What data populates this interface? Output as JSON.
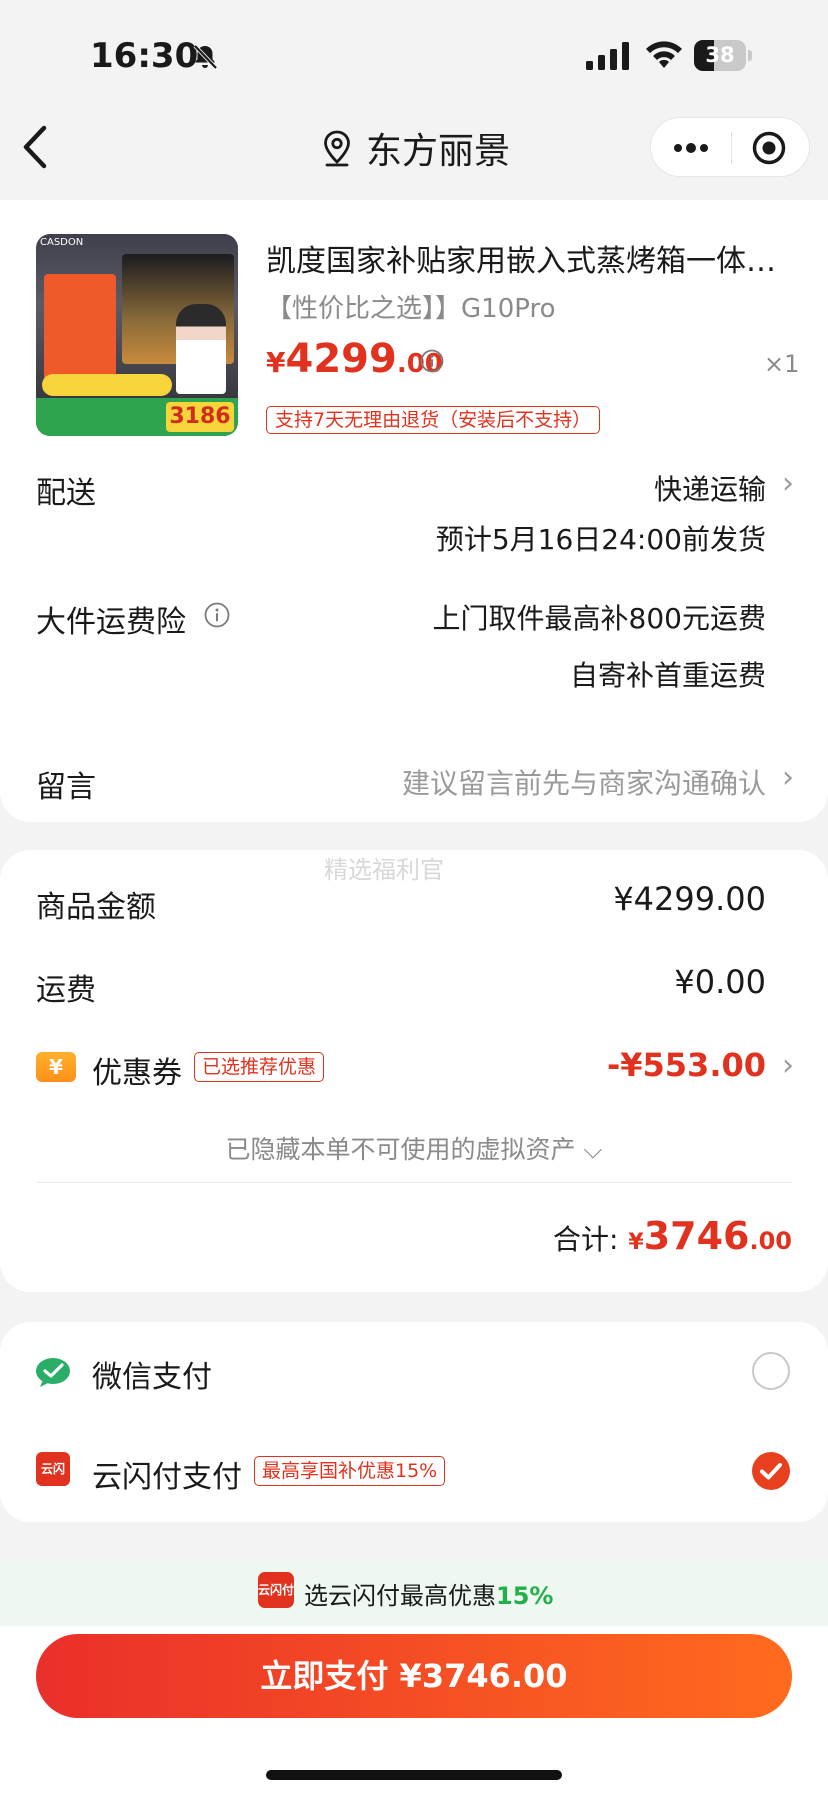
{
  "status_bar": {
    "time": "16:30",
    "battery": "38",
    "battery_level": 0.38
  },
  "nav": {
    "title": "东方丽景"
  },
  "product": {
    "title": "凯度国家补贴家用嵌入式蒸烤箱一体…",
    "spec": "【性价比之选】】G10Pro",
    "price_symbol": "¥",
    "price_int": "4299",
    "price_dec": ".00",
    "quantity": "×1",
    "return_tag": "支持7天无理由退货（安装后不支持）",
    "image_text": {
      "brand": "CASDON",
      "badge_price": "3186"
    }
  },
  "delivery": {
    "label": "配送",
    "method": "快递运输",
    "estimate": "预计5月16日24:00前发货"
  },
  "insurance": {
    "label": "大件运费险",
    "line1": "上门取件最高补800元运费",
    "line2": "自寄补首重运费"
  },
  "message": {
    "label": "留言",
    "hint": "建议留言前先与商家沟通确认"
  },
  "summary": {
    "watermark": "精选福利官",
    "goods_label": "商品金额",
    "goods_value": "¥4299.00",
    "shipping_label": "运费",
    "shipping_value": "¥0.00",
    "coupon_icon": "¥",
    "coupon_label": "优惠券",
    "coupon_tag": "已选推荐优惠",
    "coupon_value": "-¥553.00",
    "hidden_note": "已隐藏本单不可使用的虚拟资产 ⌵",
    "total_label": "合计:",
    "total_symbol": "¥",
    "total_int": "3746",
    "total_dec": ".00"
  },
  "payment": {
    "wechat_label": "微信支付",
    "wechat_selected": false,
    "yunshanfu_icon": "云闪付",
    "yunshanfu_label": "云闪付支付",
    "yunshanfu_tag": "最高享国补优惠15%",
    "yunshanfu_selected": true
  },
  "promo": {
    "icon": "云闪付",
    "text": "选云闪付最高优惠",
    "percent": "15%"
  },
  "pay_button": {
    "label": "立即支付 ¥3746.00"
  },
  "colors": {
    "accent": "#e0321e",
    "button_start": "#ea2f2a",
    "button_end": "#ff6b1e",
    "promo_green": "#22b04a",
    "wechat_green": "#2aae67"
  },
  "icons": [
    "bell-off-icon",
    "signal-icon",
    "wifi-icon",
    "battery-icon",
    "back-icon",
    "location-icon",
    "more-icon",
    "target-icon",
    "info-icon",
    "chevron-right-icon",
    "coupon-icon",
    "wechat-pay-icon",
    "yunshanfu-icon",
    "check-icon"
  ]
}
